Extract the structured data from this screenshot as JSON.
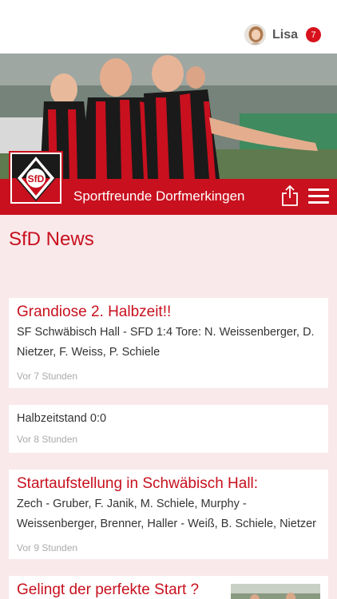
{
  "header": {
    "user_name": "Lisa",
    "notification_count": "7",
    "club_name": "Sportfreunde Dorfmerkingen",
    "logo_text": "SfD"
  },
  "page": {
    "title": "SfD News"
  },
  "news": [
    {
      "title": "Grandiose 2. Halbzeit!!",
      "text": "SF Schwäbisch Hall - SFD 1:4 Tore: N. Weissenberger, D. Nietzer, F. Weiss, P. Schiele",
      "time": "Vor 7 Stunden"
    },
    {
      "text": "Halbzeitstand 0:0",
      "time": "Vor 8 Stunden"
    },
    {
      "title": "Startaufstellung in Schwäbisch Hall:",
      "text": "Zech - Gruber, F. Janik, M. Schiele, Murphy - Weissenberger, Brenner, Haller - Weiß, B. Schiele, Nietzer",
      "time": "Vor 9 Stunden"
    },
    {
      "title": "Gelingt der perfekte Start ?"
    }
  ],
  "colors": {
    "accent": "#c8101e",
    "background": "#f9e9ea",
    "badge": "#d7121c"
  }
}
